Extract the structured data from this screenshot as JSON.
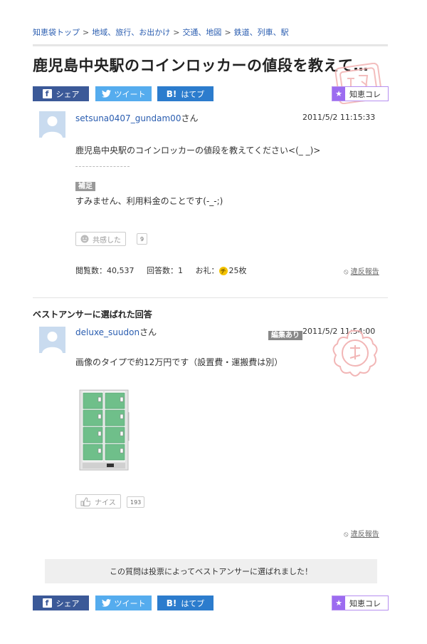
{
  "breadcrumb": [
    "知恵袋トップ",
    "地域、旅行、お出かけ",
    "交通、地図",
    "鉄道、列車、駅"
  ],
  "breadcrumb_sep": ">",
  "question": {
    "title": "鹿児島中央駅のコインロッカーの値段を教えて…",
    "username": "setsuna0407_gundam00",
    "san": "さん",
    "date": "2011/5/2  11:15:33",
    "body": "鹿児島中央駅のコインロッカーの値段を教えてください<(_ _)>",
    "supplement_tag": "補足",
    "supplement": "すみません、利用料金のことです(-_-;)",
    "empathy_label": "共感した",
    "empathy_count": "9",
    "views": "閲覧数：40,537",
    "answers": "回答数：1",
    "reward_label": "お礼：",
    "coin": "チ",
    "reward": "25枚",
    "report": "違反報告"
  },
  "share": {
    "facebook": "シェア",
    "facebook_icon": "f",
    "twitter": "ツイート",
    "twitter_icon": "bird-icon",
    "hatena": "はてブ",
    "hatena_icon": "B!",
    "chiekore": "知恵コレ",
    "star": "★"
  },
  "best_answer": {
    "heading": "ベストアンサーに選ばれた回答",
    "username": "deluxe_suudon",
    "san": "さん",
    "edited_tag": "編集あり",
    "date": "2011/5/2  11:54:00",
    "body": "画像のタイプで約12万円です（設置費・運搬費は別）",
    "nice_label": "ナイス",
    "nice_count": "193",
    "report": "違反報告"
  },
  "banner": "この質問は投票によってベストアンサーに選ばれました！",
  "colors": {
    "link": "#2a5db0",
    "facebook": "#3b5998",
    "twitter": "#55acee",
    "hatena": "#2c7ccd",
    "chiekore": "#9c6cf0",
    "stamp": "#f2b6b6",
    "locker_green": "#6fbf8a"
  }
}
